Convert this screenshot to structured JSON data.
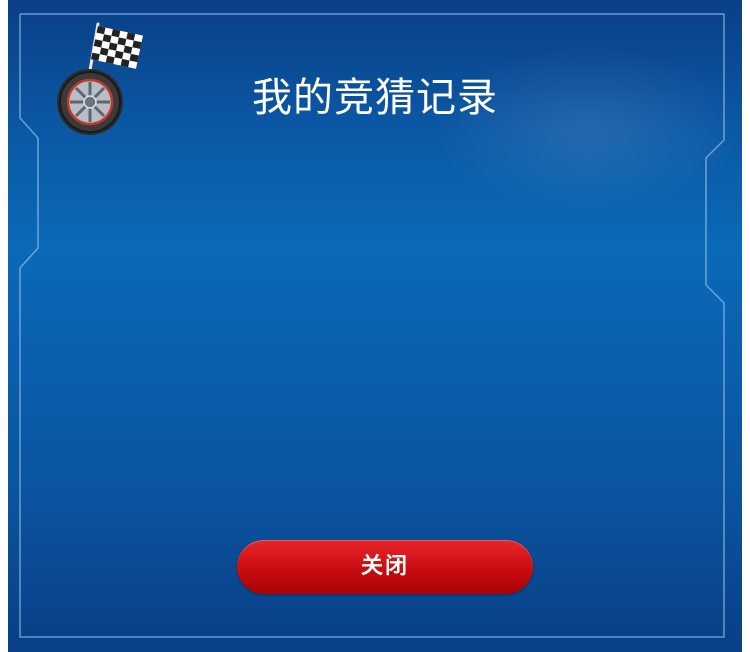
{
  "dialog": {
    "title": "我的竞猜记录",
    "close_label": "关闭"
  },
  "icons": {
    "emblem": "checkered-flag-and-tire-icon"
  },
  "colors": {
    "background_top": "#0a3f86",
    "background_mid": "#0a6ab8",
    "button_red": "#c70c10",
    "text": "#ffffff"
  }
}
